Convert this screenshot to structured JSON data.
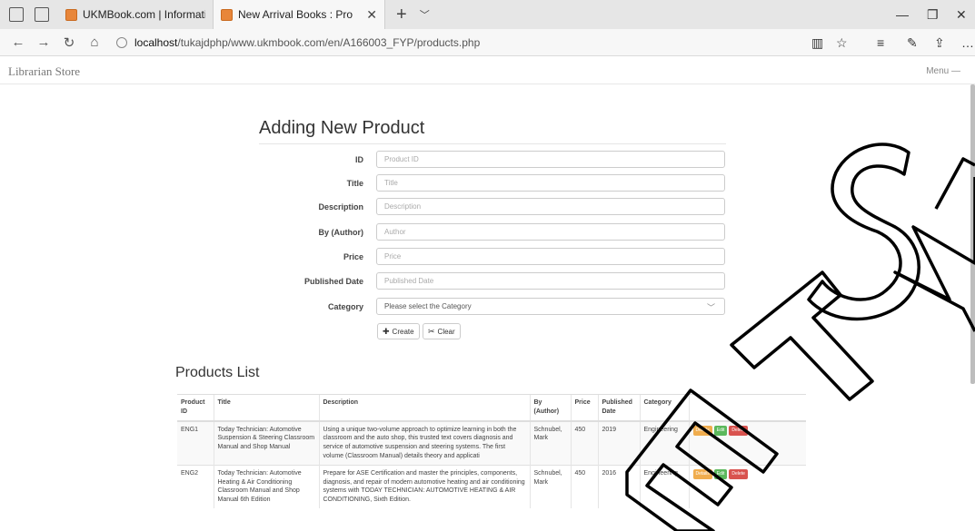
{
  "browser": {
    "tabs": [
      {
        "label": "UKMBook.com | Informatior",
        "active": false
      },
      {
        "label": "New Arrival Books : Pro",
        "active": true
      }
    ],
    "url_host": "localhost",
    "url_path": "/tukajdphp/www.ukmbook.com/en/A166003_FYP/products.php"
  },
  "navbar": {
    "brand": "Librarian Store",
    "menu": "Menu —"
  },
  "form": {
    "title": "Adding New Product",
    "fields": [
      {
        "label": "ID",
        "placeholder": "Product ID"
      },
      {
        "label": "Title",
        "placeholder": "Title"
      },
      {
        "label": "Description",
        "placeholder": "Description"
      },
      {
        "label": "By (Author)",
        "placeholder": "Author"
      },
      {
        "label": "Price",
        "placeholder": "Price"
      },
      {
        "label": "Published Date",
        "placeholder": "Published Date"
      }
    ],
    "category": {
      "label": "Category",
      "selected": "Please select the Category"
    },
    "create_label": "Create",
    "clear_label": "Clear"
  },
  "products": {
    "title": "Products List",
    "headers": [
      "Product ID",
      "Title",
      "Description",
      "By (Author)",
      "Price",
      "Published Date",
      "Category",
      ""
    ],
    "actions": {
      "details": "Details",
      "edit": "Edit",
      "delete": "Delete"
    },
    "rows": [
      {
        "id": "ENG1",
        "title": "Today Technician: Automotive Suspension & Steering Classroom Manual and Shop Manual",
        "description": "Using a unique two-volume approach to optimize learning in both the classroom and the auto shop, this trusted text covers diagnosis and service of automotive suspension and steering systems. The first volume (Classroom Manual) details theory and applicati",
        "author": "Schnubel, Mark",
        "price": "450",
        "date": "2019",
        "category": "Engineering"
      },
      {
        "id": "ENG2",
        "title": "Today Technician: Automotive Heating & Air Conditioning Classroom Manual and Shop Manual 6th Edition",
        "description": "Prepare for ASE Certification and master the principles, components, diagnosis, and repair of modern automotive heating and air conditioning systems with TODAY TECHNICIAN: AUTOMOTIVE HEATING & AIR CONDITIONING, Sixth Edition.",
        "author": "Schnubel, Mark",
        "price": "450",
        "date": "2016",
        "category": "Engineering"
      }
    ]
  },
  "watermark": "ETSM",
  "colors": {
    "details": "#f0ad4e",
    "edit": "#5cb85c",
    "delete": "#d9534f",
    "favicon": "#e8863a"
  }
}
